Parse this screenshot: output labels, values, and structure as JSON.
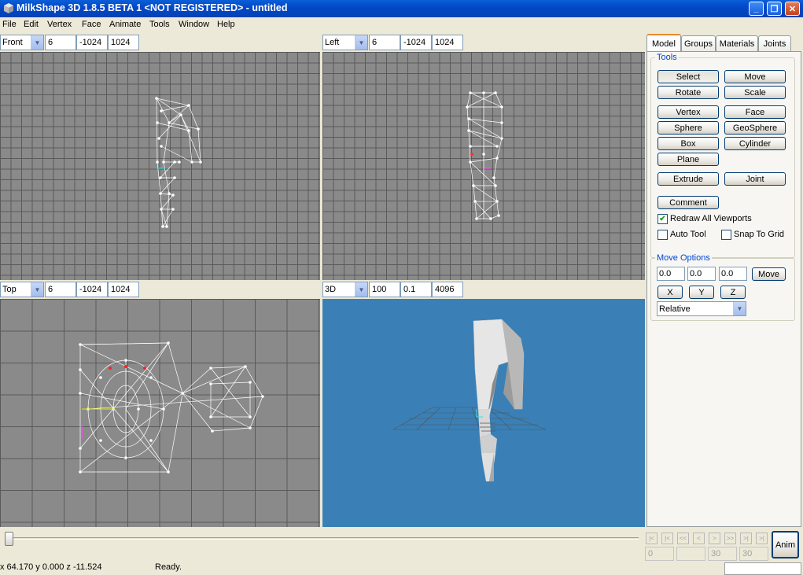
{
  "window": {
    "title": "MilkShape 3D 1.8.5 BETA 1 <NOT REGISTERED> - untitled",
    "minimize_label": "_",
    "maximize_label": "❐",
    "close_label": "✕"
  },
  "menu": [
    "File",
    "Edit",
    "Vertex",
    "Face",
    "Animate",
    "Tools",
    "Window",
    "Help"
  ],
  "viewports": {
    "front": {
      "view": "Front",
      "grid": "6",
      "min": "-1024",
      "max": "1024"
    },
    "left": {
      "view": "Left",
      "grid": "6",
      "min": "-1024",
      "max": "1024"
    },
    "top": {
      "view": "Top",
      "grid": "6",
      "min": "-1024",
      "max": "1024"
    },
    "perspective": {
      "view": "3D",
      "fov": "100",
      "near": "0.1",
      "far": "4096"
    }
  },
  "panel": {
    "tabs": [
      "Model",
      "Groups",
      "Materials",
      "Joints"
    ],
    "active_tab": "Model",
    "tools_label": "Tools",
    "tools": {
      "select": "Select",
      "move": "Move",
      "rotate": "Rotate",
      "scale": "Scale",
      "vertex": "Vertex",
      "face": "Face",
      "sphere": "Sphere",
      "geosphere": "GeoSphere",
      "box": "Box",
      "cylinder": "Cylinder",
      "plane": "Plane",
      "extrude": "Extrude",
      "joint": "Joint",
      "comment": "Comment"
    },
    "redraw_all": {
      "label": "Redraw All Viewports",
      "checked": true
    },
    "auto_tool": {
      "label": "Auto Tool",
      "checked": false
    },
    "snap_to_grid": {
      "label": "Snap To Grid",
      "checked": false
    },
    "move_options": {
      "label": "Move Options",
      "x": "0.0",
      "y": "0.0",
      "z": "0.0",
      "move_button": "Move",
      "axis_x": "X",
      "axis_y": "Y",
      "axis_z": "Z",
      "mode": "Relative"
    }
  },
  "timeline": {
    "start": "0",
    "end_a": "30",
    "end_b": "30",
    "anim_label": "Anim",
    "nav": [
      "|<",
      "|<",
      "<<",
      "<",
      ">",
      ">>",
      ">|",
      ">|"
    ]
  },
  "status": {
    "coords": "x 64.170 y 0.000 z -11.524",
    "message": "Ready."
  },
  "colors": {
    "title_bar": "#0348c8",
    "viewport_grid_bg": "#8a8a8a",
    "viewport_3d_bg": "#3a80b6",
    "group_label": "#0046d5",
    "tab_highlight": "#e68b2c"
  }
}
